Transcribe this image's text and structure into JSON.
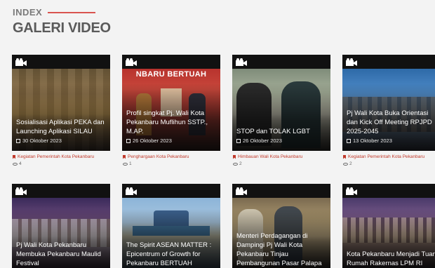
{
  "header": {
    "index_label": "INDEX",
    "title": "GALERI VIDEO"
  },
  "cards": [
    {
      "title": "Sosialisasi Aplikasi PEKA dan Launching Aplikasi SILAU",
      "date": "30 Oktober 2023",
      "category": "Kegiatan Pemerintah Kota Pekanbaru",
      "views": "4",
      "banner": ""
    },
    {
      "title": "Profil singkat Pj. Wali Kota Pekanbaru Muflihun SSTP., M.AP.",
      "date": "26 Oktober 2023",
      "category": "Penghargaan Kota Pekanbaru",
      "views": "1",
      "banner": "NBARU BERTUAH"
    },
    {
      "title": "STOP dan TOLAK LGBT",
      "date": "26 Oktober 2023",
      "category": "Himbauan Wali Kota Pekanbaru",
      "views": "2",
      "banner": ""
    },
    {
      "title": "Pj Wali Kota Buka Orientasi dan Kick Off Meeting RPJPD 2025-2045",
      "date": "13 Oktober 2023",
      "category": "Kegiatan Pemerintah Kota Pekanbaru",
      "views": "2",
      "banner": ""
    },
    {
      "title": "Pj Wali Kota Pekanbaru Membuka Pekanbaru Maulid Festival",
      "date": "",
      "category": "",
      "views": "",
      "banner": ""
    },
    {
      "title": "The Spirit ASEAN MATTER : Epicentrum of Growth for Pekanbaru BERTUAH",
      "date": "",
      "category": "",
      "views": "",
      "banner": ""
    },
    {
      "title": "Menteri Perdagangan di Dampingi Pj Wali Kota Pekanbaru Tinjau Pembangunan Pasar Palapa",
      "date": "",
      "category": "",
      "views": "",
      "banner": ""
    },
    {
      "title": "Kota Pekanbaru Menjadi Tuan Rumah Rakernas LPM RI",
      "date": "",
      "category": "",
      "views": "",
      "banner": ""
    }
  ],
  "theme": {
    "accent": "#d9534f",
    "category_color": "#c0392b"
  }
}
